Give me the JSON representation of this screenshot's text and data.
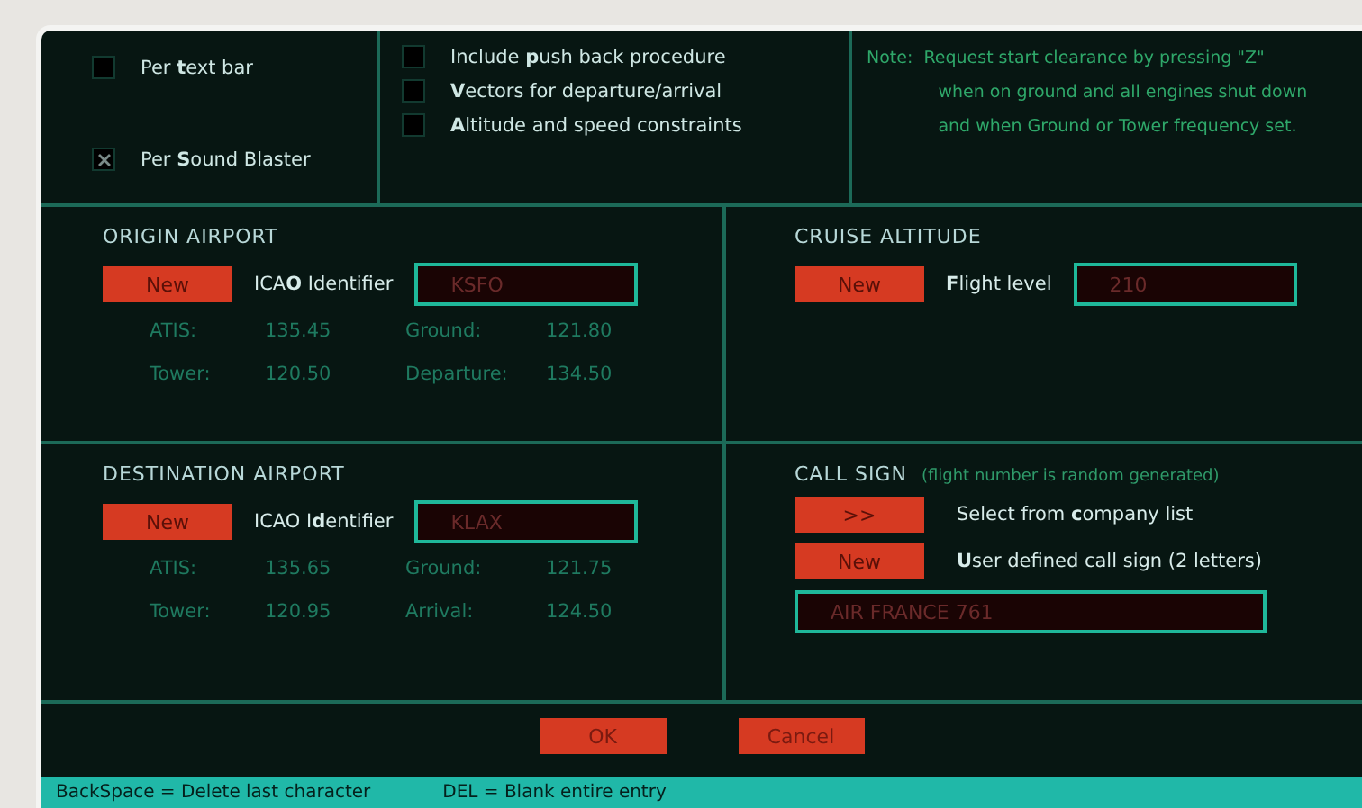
{
  "options_left": [
    {
      "label": "Per **t**ext bar",
      "checked": false
    },
    {
      "label": "Per **S**ound Blaster",
      "checked": true
    }
  ],
  "options_middle": [
    {
      "label": "Include **p**ush back procedure",
      "checked": false
    },
    {
      "label": "**V**ectors for departure/arrival",
      "checked": false
    },
    {
      "label": "**A**ltitude and speed constraints",
      "checked": false
    }
  ],
  "note": {
    "label": "Note:",
    "lines": [
      "Request start clearance by pressing \"Z\"",
      "when on ground and all engines shut down",
      "and when Ground or Tower frequency set."
    ]
  },
  "origin": {
    "title": "ORIGIN AIRPORT",
    "button": "New",
    "field_label": "ICA**O** Identifier",
    "value": "KSFO",
    "frequencies": [
      {
        "label": "ATIS:",
        "value": "135.45"
      },
      {
        "label": "Ground:",
        "value": "121.80"
      },
      {
        "label": "Tower:",
        "value": "120.50"
      },
      {
        "label": "Departure:",
        "value": "134.50"
      }
    ]
  },
  "destination": {
    "title": "DESTINATION AIRPORT",
    "button": "New",
    "field_label": "ICAO I**d**entifier",
    "value": "KLAX",
    "frequencies": [
      {
        "label": "ATIS:",
        "value": "135.65"
      },
      {
        "label": "Ground:",
        "value": "121.75"
      },
      {
        "label": "Tower:",
        "value": "120.95"
      },
      {
        "label": "Arrival:",
        "value": "124.50"
      }
    ]
  },
  "cruise": {
    "title": "CRUISE ALTITUDE",
    "button": "New",
    "field_label": "**F**light level",
    "value": "210"
  },
  "call_sign": {
    "title": "CALL SIGN",
    "hint": "(flight number is random generated)",
    "actions": [
      {
        "button": ">>",
        "label": "Select from **c**ompany list"
      },
      {
        "button": "New",
        "label": "**U**ser defined call sign (2 letters)"
      }
    ],
    "value": "AIR FRANCE 761"
  },
  "buttons": [
    "OK",
    "Cancel"
  ],
  "status_bar": [
    "BackSpace = Delete last character",
    "DEL = Blank entire entry"
  ]
}
